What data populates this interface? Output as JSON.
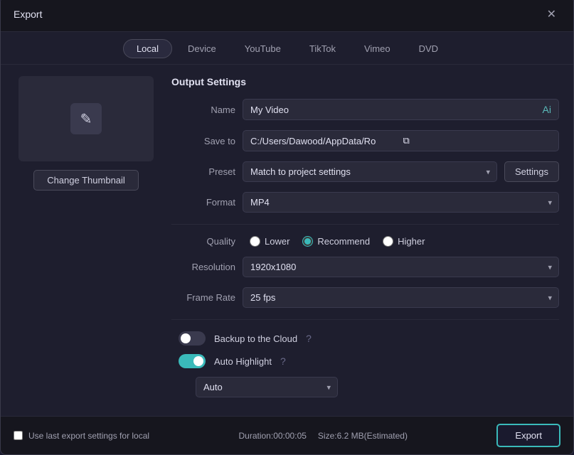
{
  "dialog": {
    "title": "Export",
    "close_label": "✕"
  },
  "tabs": {
    "items": [
      {
        "label": "Local",
        "active": true
      },
      {
        "label": "Device",
        "active": false
      },
      {
        "label": "YouTube",
        "active": false
      },
      {
        "label": "TikTok",
        "active": false
      },
      {
        "label": "Vimeo",
        "active": false
      },
      {
        "label": "DVD",
        "active": false
      }
    ]
  },
  "thumbnail": {
    "pencil_unicode": "✏",
    "change_btn_label": "Change Thumbnail"
  },
  "output_settings": {
    "section_title": "Output Settings",
    "name_label": "Name",
    "name_value": "My Video",
    "ai_icon": "Ai",
    "save_to_label": "Save to",
    "save_to_value": "C:/Users/Dawood/AppData/Ro",
    "folder_icon": "🗁",
    "preset_label": "Preset",
    "preset_value": "Match to project settings",
    "settings_btn_label": "Settings",
    "format_label": "Format",
    "format_value": "MP4",
    "quality_label": "Quality",
    "quality_options": [
      {
        "label": "Lower",
        "value": "lower",
        "checked": false
      },
      {
        "label": "Recommend",
        "value": "recommend",
        "checked": true
      },
      {
        "label": "Higher",
        "value": "higher",
        "checked": false
      }
    ],
    "resolution_label": "Resolution",
    "resolution_value": "1920x1080",
    "frame_rate_label": "Frame Rate",
    "frame_rate_value": "25 fps"
  },
  "toggles": {
    "backup_label": "Backup to the Cloud",
    "backup_on": false,
    "auto_highlight_label": "Auto Highlight",
    "auto_highlight_on": true,
    "auto_select_value": "Auto"
  },
  "footer": {
    "checkbox_label": "Use last export settings for local",
    "duration_label": "Duration:",
    "duration_value": "00:00:05",
    "size_label": "Size:",
    "size_value": "6.2 MB(Estimated)",
    "export_btn_label": "Export"
  },
  "icons": {
    "chevron_down": "▾",
    "help": "?",
    "pencil": "✎",
    "folder": "⧉",
    "close": "✕"
  }
}
